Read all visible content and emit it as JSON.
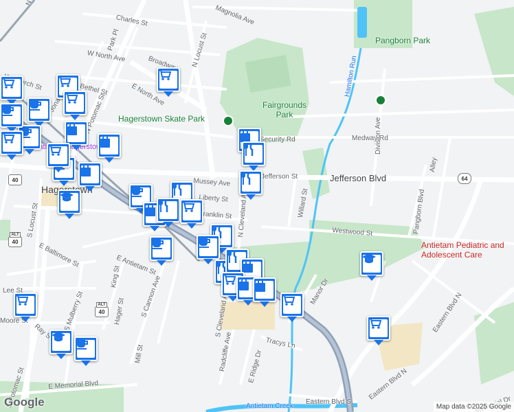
{
  "streets": {
    "charles": "Charles St",
    "park_pl": "Park Pl",
    "w_north": "W North Ave",
    "e_north": "E North Ave",
    "broadway": "Broadway",
    "n_locust": "N Locust St",
    "n_potomac": "N Potomac St",
    "church": "W Church St",
    "bethel": "Bethel St",
    "jonathan": "Jonathan St",
    "security": "Security Rd",
    "medway": "Medway Rd",
    "division": "Division Ave",
    "jefferson": "Jefferson St",
    "jefferson_blvd": "Jefferson Blvd",
    "mussey": "Mussey Ave",
    "liberty": "Liberty St",
    "franklin": "Franklin St",
    "n_cleveland": "N Cleveland Ave",
    "willard": "Willard St",
    "westwood": "Westwood St",
    "pangborn_blvd": "Pangborn Blvd",
    "alley": "Alley",
    "e_antietam": "E Antietam St",
    "s_cannon": "S Cannon Ave",
    "s_locust": "S Locust St",
    "e_baltimore": "E Baltimore St",
    "king": "King St",
    "hager": "Hager St",
    "mill": "Mill St",
    "s_mulberry": "S Mulberry St",
    "s_potomac": "S Potomac St",
    "lee": "Lee St",
    "moore": "Moore St",
    "ray": "Ray St",
    "s_cleveland": "S Cleveland Ave",
    "radcliffe": "Radcliffe Ave",
    "e_ridge": "E Ridge Dr",
    "tracys": "Tracys Ln",
    "manor": "Manor Dr",
    "e_memorial": "E Memorial Blvd",
    "eastern_s": "Eastern Blvd S",
    "eastern_n": "Eastern Blvd N",
    "antietam_creek": "Antietam Creek",
    "hamilton_run": "Hamilton Run",
    "memorial_short": "Memorial Dr",
    "magnolia": "Magnolia Ave",
    "n_top": "N"
  },
  "places": {
    "pangborn_park": "Pangborn Park",
    "fairgrounds_park": "Fairgrounds Park",
    "skate_park": "Hagerstown Skate Park",
    "antietam_pediatric": "Antietam Pediatric and Adolescent Care",
    "hagerstown": "Hagerstown",
    "hotel_partial": "Station at Hagerstown"
  },
  "shields": {
    "alt40_a": "40",
    "alt40_b": "40",
    "alt40_c": "40",
    "us40": "40",
    "md64": "64",
    "alt_label": "ALT"
  },
  "attribution": {
    "google": "Google",
    "map_data": "Map data ©2025 Google"
  },
  "colors": {
    "pin": "#1a73e8",
    "park": "#c8e6c9",
    "water": "#4fc3f7",
    "highway": "#8ea0b8",
    "poi_red": "#c5221f"
  },
  "markers": [
    {
      "icon": "shopping-cart-icon"
    },
    {
      "icon": "shopping-cart-icon"
    },
    {
      "icon": "cafe-icon"
    },
    {
      "icon": "cafe-icon"
    },
    {
      "icon": "shopping-cart-icon"
    },
    {
      "icon": "shopping-bag-icon"
    },
    {
      "icon": "shopping-bag-icon"
    },
    {
      "icon": "cafe-icon"
    },
    {
      "icon": "shopping-bag-icon"
    },
    {
      "icon": "school-icon"
    },
    {
      "icon": "shopping-cart-icon"
    },
    {
      "icon": "shopping-bag-icon"
    },
    {
      "icon": "restaurant-icon"
    },
    {
      "icon": "restaurant-icon"
    },
    {
      "icon": "restaurant-icon"
    },
    {
      "icon": "cafe-icon"
    },
    {
      "icon": "shopping-bag-icon"
    },
    {
      "icon": "restaurant-icon"
    },
    {
      "icon": "shopping-cart-icon"
    },
    {
      "icon": "cafe-icon"
    },
    {
      "icon": "restaurant-icon"
    },
    {
      "icon": "cafe-icon"
    },
    {
      "icon": "restaurant-icon"
    },
    {
      "icon": "restaurant-icon"
    },
    {
      "icon": "shopping-bag-icon"
    },
    {
      "icon": "shopping-cart-icon"
    },
    {
      "icon": "shopping-bag-icon"
    },
    {
      "icon": "shopping-bag-icon"
    },
    {
      "icon": "shopping-cart-icon"
    },
    {
      "icon": "school-icon"
    },
    {
      "icon": "shopping-cart-icon"
    },
    {
      "icon": "shopping-cart-icon"
    },
    {
      "icon": "school-icon"
    },
    {
      "icon": "cafe-icon"
    },
    {
      "icon": "shopping-cart-icon"
    },
    {
      "icon": "cafe-icon"
    },
    {
      "icon": "shopping-cart-icon"
    }
  ]
}
